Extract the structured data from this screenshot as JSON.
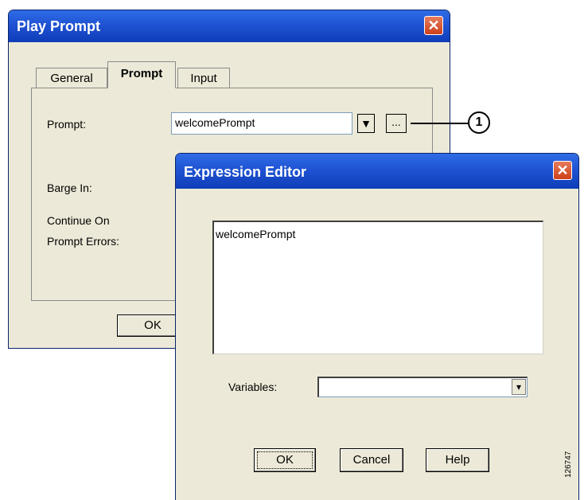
{
  "play_prompt": {
    "title": "Play Prompt",
    "close_glyph": "✕",
    "tabs": [
      "General",
      "Prompt",
      "Input"
    ],
    "prompt_label": "Prompt:",
    "prompt_value": "welcomePrompt",
    "dropdown_glyph": "▼",
    "ellipsis_label": "...",
    "barge_in_label": "Barge In:",
    "continue_label_1": "Continue On",
    "continue_label_2": "Prompt Errors:",
    "ok_label": "OK"
  },
  "callout": {
    "number": "1"
  },
  "expression_editor": {
    "title": "Expression Editor",
    "close_glyph": "✕",
    "expression_text": "welcomePrompt",
    "variables_label": "Variables:",
    "variables_value": "",
    "variables_arrow": "▾",
    "ok_label": "OK",
    "cancel_label": "Cancel",
    "help_label": "Help"
  },
  "figure_id": "126747"
}
